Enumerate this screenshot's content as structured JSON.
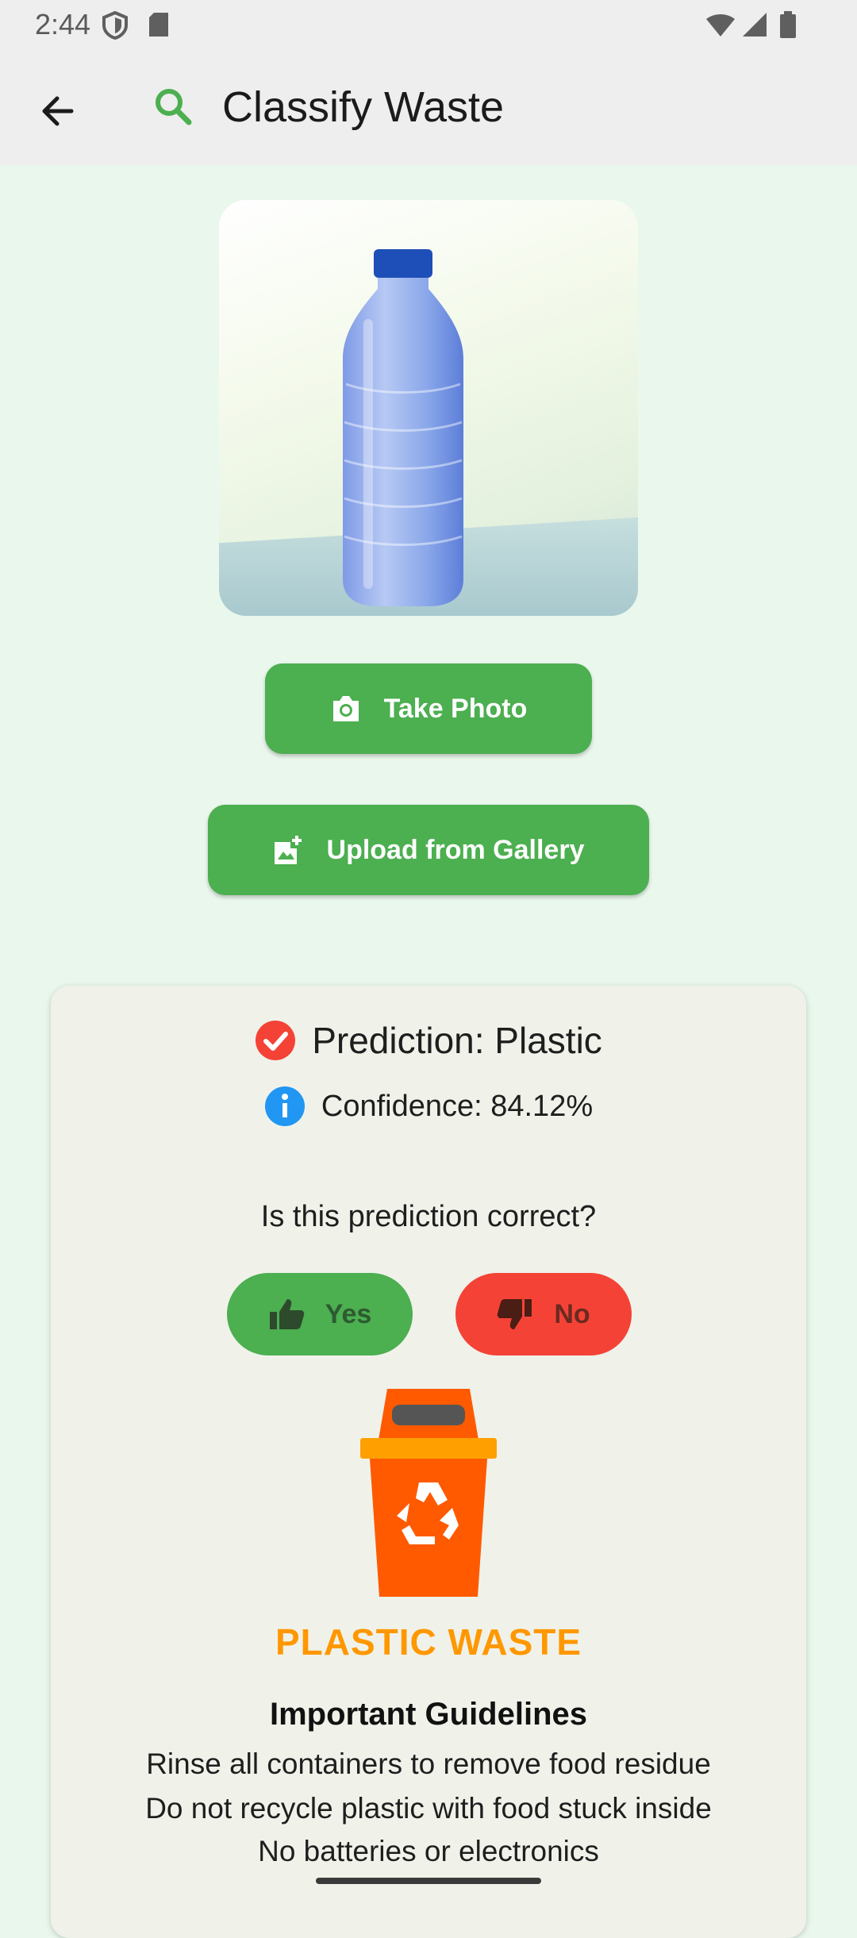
{
  "status_bar": {
    "time": "2:44"
  },
  "app_bar": {
    "title": "Classify Waste"
  },
  "buttons": {
    "take_photo": "Take Photo",
    "upload_gallery": "Upload from Gallery"
  },
  "result": {
    "prediction": "Prediction: Plastic",
    "confidence": "Confidence: 84.12%",
    "question": "Is this prediction correct?",
    "yes_label": "Yes",
    "no_label": "No"
  },
  "category": {
    "name": "PLASTIC WASTE",
    "color": "#ff9800",
    "guidelines_title": "Important Guidelines",
    "guidelines": [
      "Rinse all containers to remove food residue",
      "Do not recycle plastic with food stuck inside",
      "No batteries or electronics"
    ]
  },
  "colors": {
    "primary_green": "#4caf50",
    "no_red": "#f44336",
    "bin_orange": "#ff5a00"
  }
}
